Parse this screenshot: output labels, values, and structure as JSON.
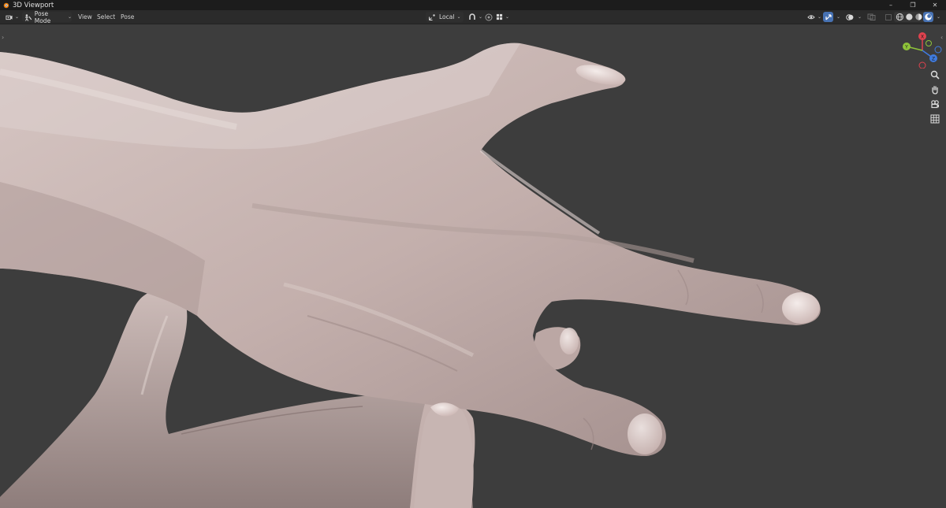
{
  "window": {
    "title": "3D Viewport"
  },
  "window_controls": {
    "minimize": "–",
    "maximize": "❐",
    "close": "✕"
  },
  "header": {
    "mode_label": "Pose Mode",
    "menus": [
      "View",
      "Select",
      "Pose"
    ],
    "transform_pivot_label": "Local"
  },
  "colors": {
    "background": "#3d3d3d",
    "header": "#2b2b2b",
    "titlebar": "#1c1c1c",
    "accent": "#4772b3",
    "axis_x": "#e0424e",
    "axis_y": "#8fc43a",
    "axis_z": "#3f7be0",
    "skin": "#c9b8b5"
  },
  "icons": {
    "app": "blender-icon",
    "editor_type": "editor-type-icon",
    "pose_mode": "pose-mode-icon",
    "orientation": "transform-orientation-icon",
    "snap": "snap-icon",
    "proportional": "proportional-edit-icon",
    "visibility": "visibility-icon",
    "gizmo": "gizmo-icon",
    "overlays": "overlays-icon",
    "xray": "xray-icon",
    "shading": [
      "wireframe-shading-icon",
      "solid-shading-icon",
      "material-shading-icon",
      "rendered-shading-icon"
    ],
    "nav": [
      "zoom-icon",
      "pan-hand-icon",
      "camera-icon",
      "grid-icon"
    ]
  },
  "gizmo_axes": {
    "x": "X",
    "y": "Y",
    "z": "Z"
  }
}
